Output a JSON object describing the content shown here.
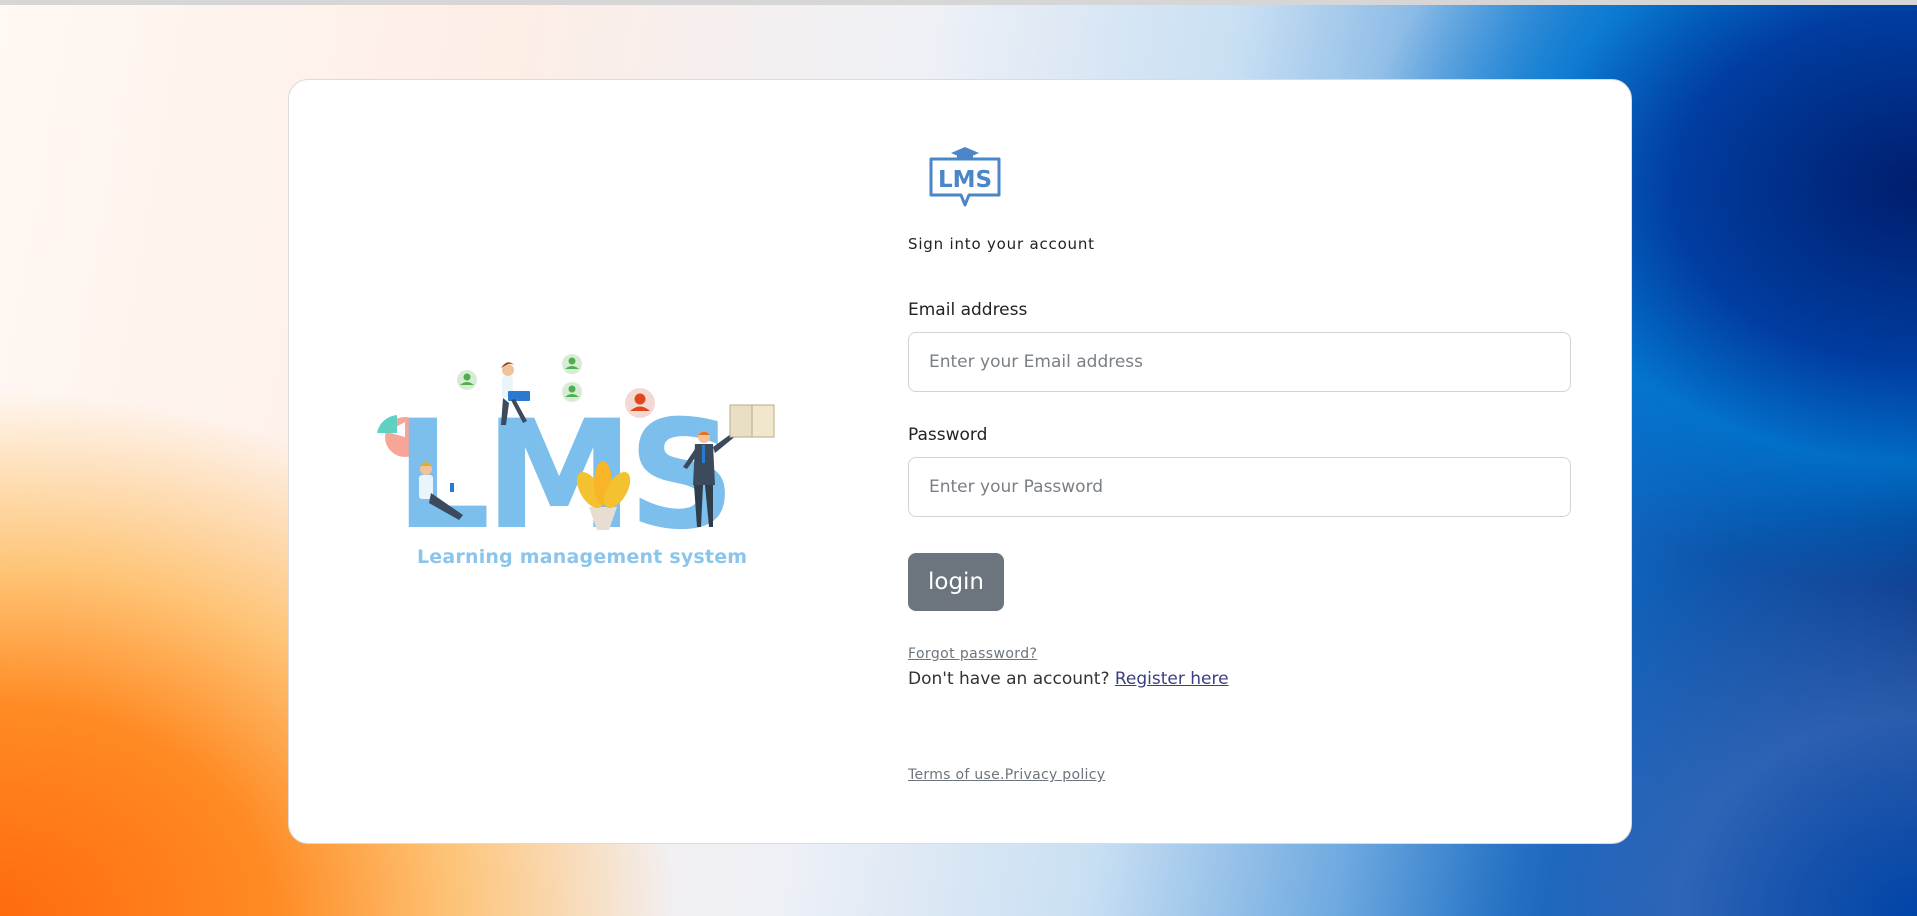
{
  "illustration": {
    "letters": "LMS",
    "tagline": "Learning management system"
  },
  "login": {
    "subtitle": "Sign into your account",
    "email_label": "Email address",
    "email_placeholder": "Enter your Email address",
    "email_value": "",
    "password_label": "Password",
    "password_placeholder": "Enter your Password",
    "password_value": "",
    "login_label": "login",
    "forgot_label": "Forgot password?",
    "no_account_text": "Don't have an account? ",
    "register_label": "Register here",
    "terms_label": "Terms of use.",
    "privacy_label": "Privacy policy"
  },
  "logo": {
    "text": "LMS"
  },
  "colors": {
    "button_bg": "#6c757d",
    "logo_blue": "#4a86c8",
    "illustration_blue": "#7cbfec",
    "register_link": "#393f81"
  }
}
